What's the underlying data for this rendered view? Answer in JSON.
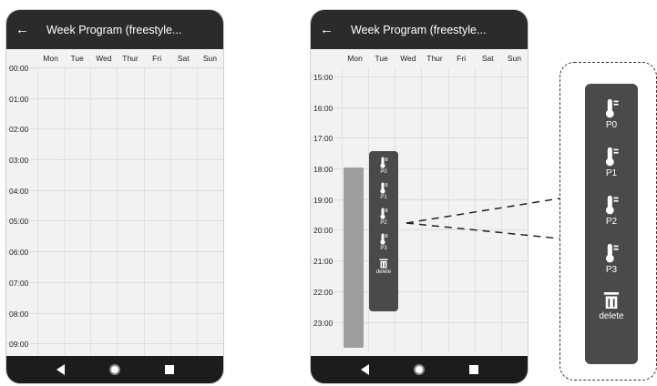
{
  "left_phone": {
    "title": "Week Program (freestyle...",
    "days": [
      "Mon",
      "Tue",
      "Wed",
      "Thur",
      "Fri",
      "Sat",
      "Sun"
    ],
    "times": [
      "00:00",
      "01:00",
      "02:00",
      "03:00",
      "04:00",
      "05:00",
      "06:00",
      "07:00",
      "08:00",
      "09:00"
    ]
  },
  "right_phone": {
    "title": "Week Program (freestyle...",
    "days": [
      "Mon",
      "Tue",
      "Wed",
      "Thur",
      "Fri",
      "Sat",
      "Sun"
    ],
    "times": [
      "15:00",
      "16:00",
      "17:00",
      "18:00",
      "19:00",
      "20:00",
      "21:00",
      "22:00",
      "23:00"
    ],
    "popup_items": [
      "P0",
      "P1",
      "P2",
      "P3"
    ],
    "delete_label": "delete"
  },
  "zoom_panel": {
    "items": [
      "P0",
      "P1",
      "P2",
      "P3"
    ],
    "delete_label": "delete"
  },
  "icons": {
    "back": "back-arrow-icon",
    "thermometer": "thermometer-icon",
    "trash": "trash-icon",
    "nav_back": "nav-back-icon",
    "nav_home": "nav-home-icon",
    "nav_recent": "nav-recent-icon"
  }
}
